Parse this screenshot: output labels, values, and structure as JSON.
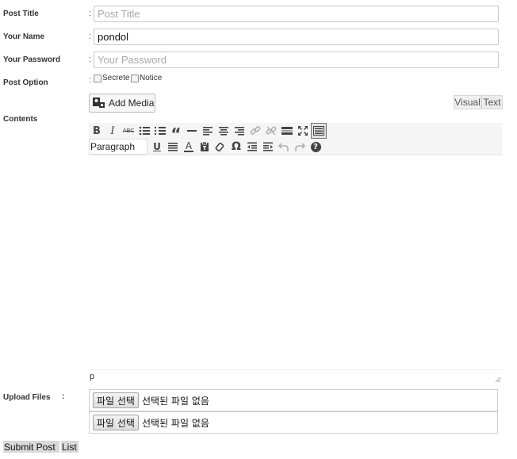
{
  "form": {
    "post_title": {
      "label": "Post Title",
      "colon": ":",
      "placeholder": "Post Title",
      "value": ""
    },
    "your_name": {
      "label": "Your Name",
      "colon": ":",
      "value": "pondol"
    },
    "your_password": {
      "label": "Your Password",
      "colon": ":",
      "placeholder": "Your Password",
      "value": ""
    },
    "post_option": {
      "label": "Post Option",
      "colon": ":",
      "options": [
        {
          "label": "Secrete",
          "checked": false
        },
        {
          "label": "Notice",
          "checked": false
        }
      ]
    },
    "contents": {
      "label": "Contents"
    },
    "upload": {
      "label": "Upload Files",
      "colon": ":"
    }
  },
  "editor": {
    "add_media_label": "Add Media",
    "tabs": {
      "visual": "Visual",
      "text": "Text"
    },
    "paragraph_label": "Paragraph",
    "path_label": "p",
    "toolbar_row1_icons": [
      "bold-icon",
      "italic-icon",
      "strikethrough-icon",
      "bullet-list-icon",
      "numbered-list-icon",
      "blockquote-icon",
      "horizontal-line-icon",
      "align-left-icon",
      "align-center-icon",
      "align-right-icon",
      "insert-link-icon",
      "remove-link-icon",
      "read-more-icon",
      "fullscreen-icon",
      "toolbar-toggle-icon"
    ],
    "toolbar_row2_icons": [
      "underline-icon",
      "justify-icon",
      "text-color-icon",
      "paste-text-icon",
      "clear-formatting-icon",
      "special-character-icon",
      "outdent-icon",
      "indent-icon",
      "undo-icon",
      "redo-icon",
      "help-icon"
    ],
    "glyphs": {
      "bold": "B",
      "italic": "I",
      "strikethrough": "ABC",
      "blockquote": "“",
      "underline": "U",
      "special_char": "Ω",
      "help": "?",
      "text_color": "A"
    }
  },
  "files": [
    {
      "button_label": "파일 선택",
      "status": "선택된 파일 없음"
    },
    {
      "button_label": "파일 선택",
      "status": "선택된 파일 없음"
    }
  ],
  "actions": {
    "submit_label": "Submit Post",
    "list_label": "List"
  }
}
